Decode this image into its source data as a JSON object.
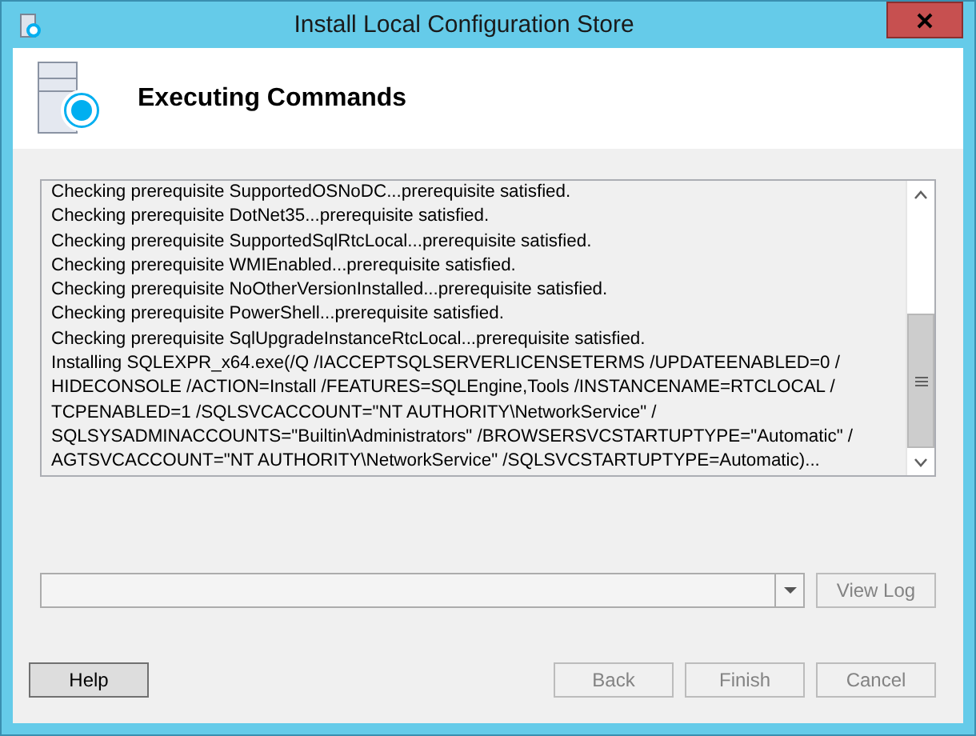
{
  "window": {
    "title": "Install Local Configuration Store"
  },
  "header": {
    "title": "Executing Commands"
  },
  "log": {
    "lines": [
      "Checking prerequisite SupportedOSNoDC...prerequisite satisfied.",
      "Checking prerequisite DotNet35...prerequisite satisfied.",
      "Checking prerequisite SupportedSqlRtcLocal...prerequisite satisfied.",
      "Checking prerequisite WMIEnabled...prerequisite satisfied.",
      "Checking prerequisite NoOtherVersionInstalled...prerequisite satisfied.",
      "Checking prerequisite PowerShell...prerequisite satisfied.",
      "Checking prerequisite SqlUpgradeInstanceRtcLocal...prerequisite satisfied.",
      "Installing SQLEXPR_x64.exe(/Q /IACCEPTSQLSERVERLICENSETERMS /UPDATEENABLED=0 / HIDECONSOLE /ACTION=Install /FEATURES=SQLEngine,Tools /INSTANCENAME=RTCLOCAL / TCPENABLED=1 /SQLSVCACCOUNT=\"NT AUTHORITY\\NetworkService\" / SQLSYSADMINACCOUNTS=\"Builtin\\Administrators\" /BROWSERSVCSTARTUPTYPE=\"Automatic\" / AGTSVCACCOUNT=\"NT AUTHORITY\\NetworkService\" /SQLSVCSTARTUPTYPE=Automatic)..."
    ]
  },
  "view_log_button": {
    "label": "View Log",
    "disabled": true
  },
  "buttons": [
    {
      "label": "Help",
      "disabled": false
    },
    {
      "label": "Back",
      "disabled": true
    },
    {
      "label": "Finish",
      "disabled": true
    },
    {
      "label": "Cancel",
      "disabled": true
    }
  ]
}
